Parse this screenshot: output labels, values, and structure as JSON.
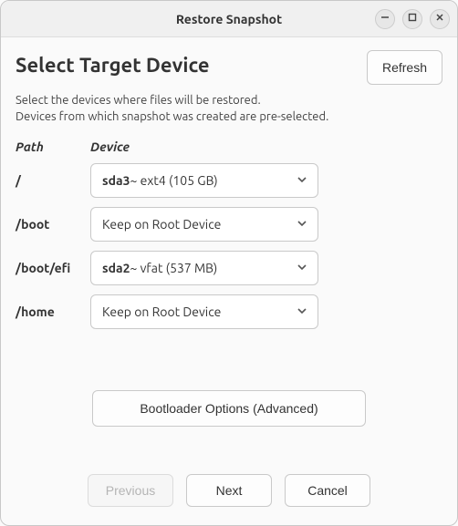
{
  "window": {
    "title": "Restore Snapshot"
  },
  "header": {
    "title": "Select Target Device",
    "refresh_label": "Refresh"
  },
  "description": {
    "line1": "Select the devices where files will be restored.",
    "line2": "Devices from which snapshot was created are pre-selected."
  },
  "table": {
    "headers": {
      "path": "Path",
      "device": "Device"
    },
    "rows": [
      {
        "path": "/",
        "dev_bold": "sda3",
        "dev_rest": " ~ ext4 (105 GB)"
      },
      {
        "path": "/boot",
        "dev_bold": "",
        "dev_rest": "Keep on Root Device"
      },
      {
        "path": "/boot/efi",
        "dev_bold": "sda2",
        "dev_rest": " ~ vfat (537 MB)"
      },
      {
        "path": "/home",
        "dev_bold": "",
        "dev_rest": "Keep on Root Device"
      }
    ]
  },
  "bootloader": {
    "label": "Bootloader Options (Advanced)"
  },
  "footer": {
    "previous": "Previous",
    "next": "Next",
    "cancel": "Cancel"
  }
}
